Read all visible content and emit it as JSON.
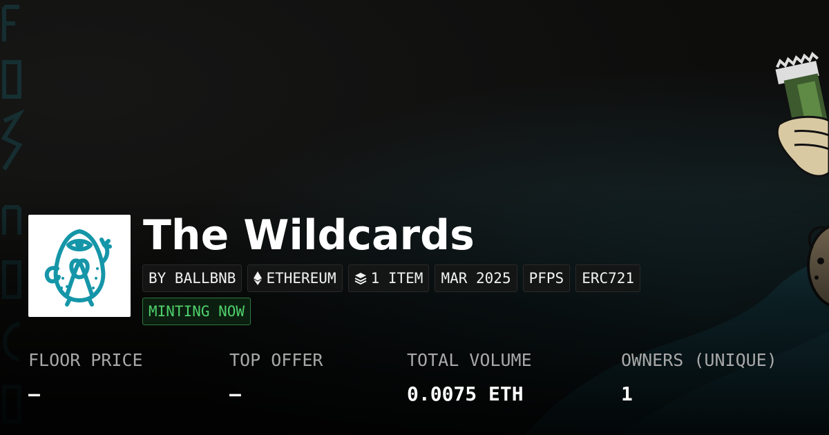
{
  "collection": {
    "title": "The Wildcards",
    "logo_icon": "wildcards-mascot-logo",
    "logo_color": "#1596a8",
    "tags": [
      {
        "label": "BY BALLBNB",
        "icon": null
      },
      {
        "label": "ETHEREUM",
        "icon": "ethereum-icon"
      },
      {
        "label": "1 ITEM",
        "icon": "layers-icon"
      },
      {
        "label": "MAR 2025",
        "icon": null
      },
      {
        "label": "PFPS",
        "icon": null
      },
      {
        "label": "ERC721",
        "icon": null
      }
    ],
    "status": "MINTING NOW",
    "status_color": "#4fd06b"
  },
  "stats": [
    {
      "label": "FLOOR PRICE",
      "value": "—"
    },
    {
      "label": "TOP OFFER",
      "value": "—"
    },
    {
      "label": "TOTAL VOLUME",
      "value": "0.0075 ETH"
    },
    {
      "label": "OWNERS (UNIQUE)",
      "value": "1"
    }
  ],
  "colors": {
    "background": "#0d0d0c",
    "accent_teal": "#1596a8",
    "label_gray": "#a8a8a8"
  }
}
